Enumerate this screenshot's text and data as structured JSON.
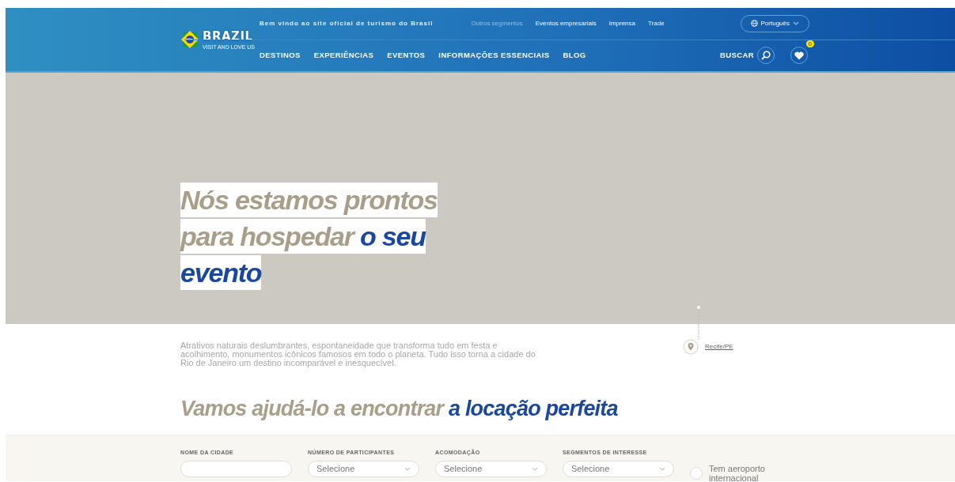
{
  "header": {
    "logo": {
      "name": "BRAZIL",
      "tagline": "VISIT AND LOVE US"
    },
    "welcome": "Bem vindo ao site oficial de turismo do Brasil",
    "top_links": [
      {
        "label": "Outros segmentos",
        "selected": true
      },
      {
        "label": "Eventos empresariais",
        "selected": false
      },
      {
        "label": "Imprensa",
        "selected": false
      },
      {
        "label": "Trade",
        "selected": false
      }
    ],
    "language": "Português",
    "nav": [
      "DESTINOS",
      "EXPERIÊNCIAS",
      "EVENTOS",
      "INFORMAÇÕES ESSENCIAIS",
      "BLOG"
    ],
    "search_label": "BUSCAR",
    "favorites_count": "0"
  },
  "hero": {
    "title_lead": " Nós estamos prontos para hospedar ",
    "title_accent": "o seu evento"
  },
  "intro": "Atrativos naturais deslumbrantes, espontaneidade que transforma tudo em festa e acolhimento, monumentos icônicos famosos em todo o planeta. Tudo isso torna a cidade do Rio de Janeiro um destino incomparável e inesquecível.",
  "location": "Recife/PE",
  "finder": {
    "title_lead": "Vamos ajudá-lo a encontrar ",
    "title_accent": "a locação perfeita",
    "fields": [
      {
        "kind": "text",
        "label": "NOME DA CIDADE"
      },
      {
        "kind": "select",
        "label": "NÚMERO DE PARTICIPANTES",
        "value": "Selecione"
      },
      {
        "kind": "select",
        "label": "ACOMODAÇÃO",
        "value": "Selecione"
      },
      {
        "kind": "select",
        "label": "SEGMENTOS DE INTERESSE",
        "value": "Selecione"
      },
      {
        "kind": "checkbox",
        "label": "Tem aeroporto internacional",
        "checked": false
      }
    ]
  }
}
